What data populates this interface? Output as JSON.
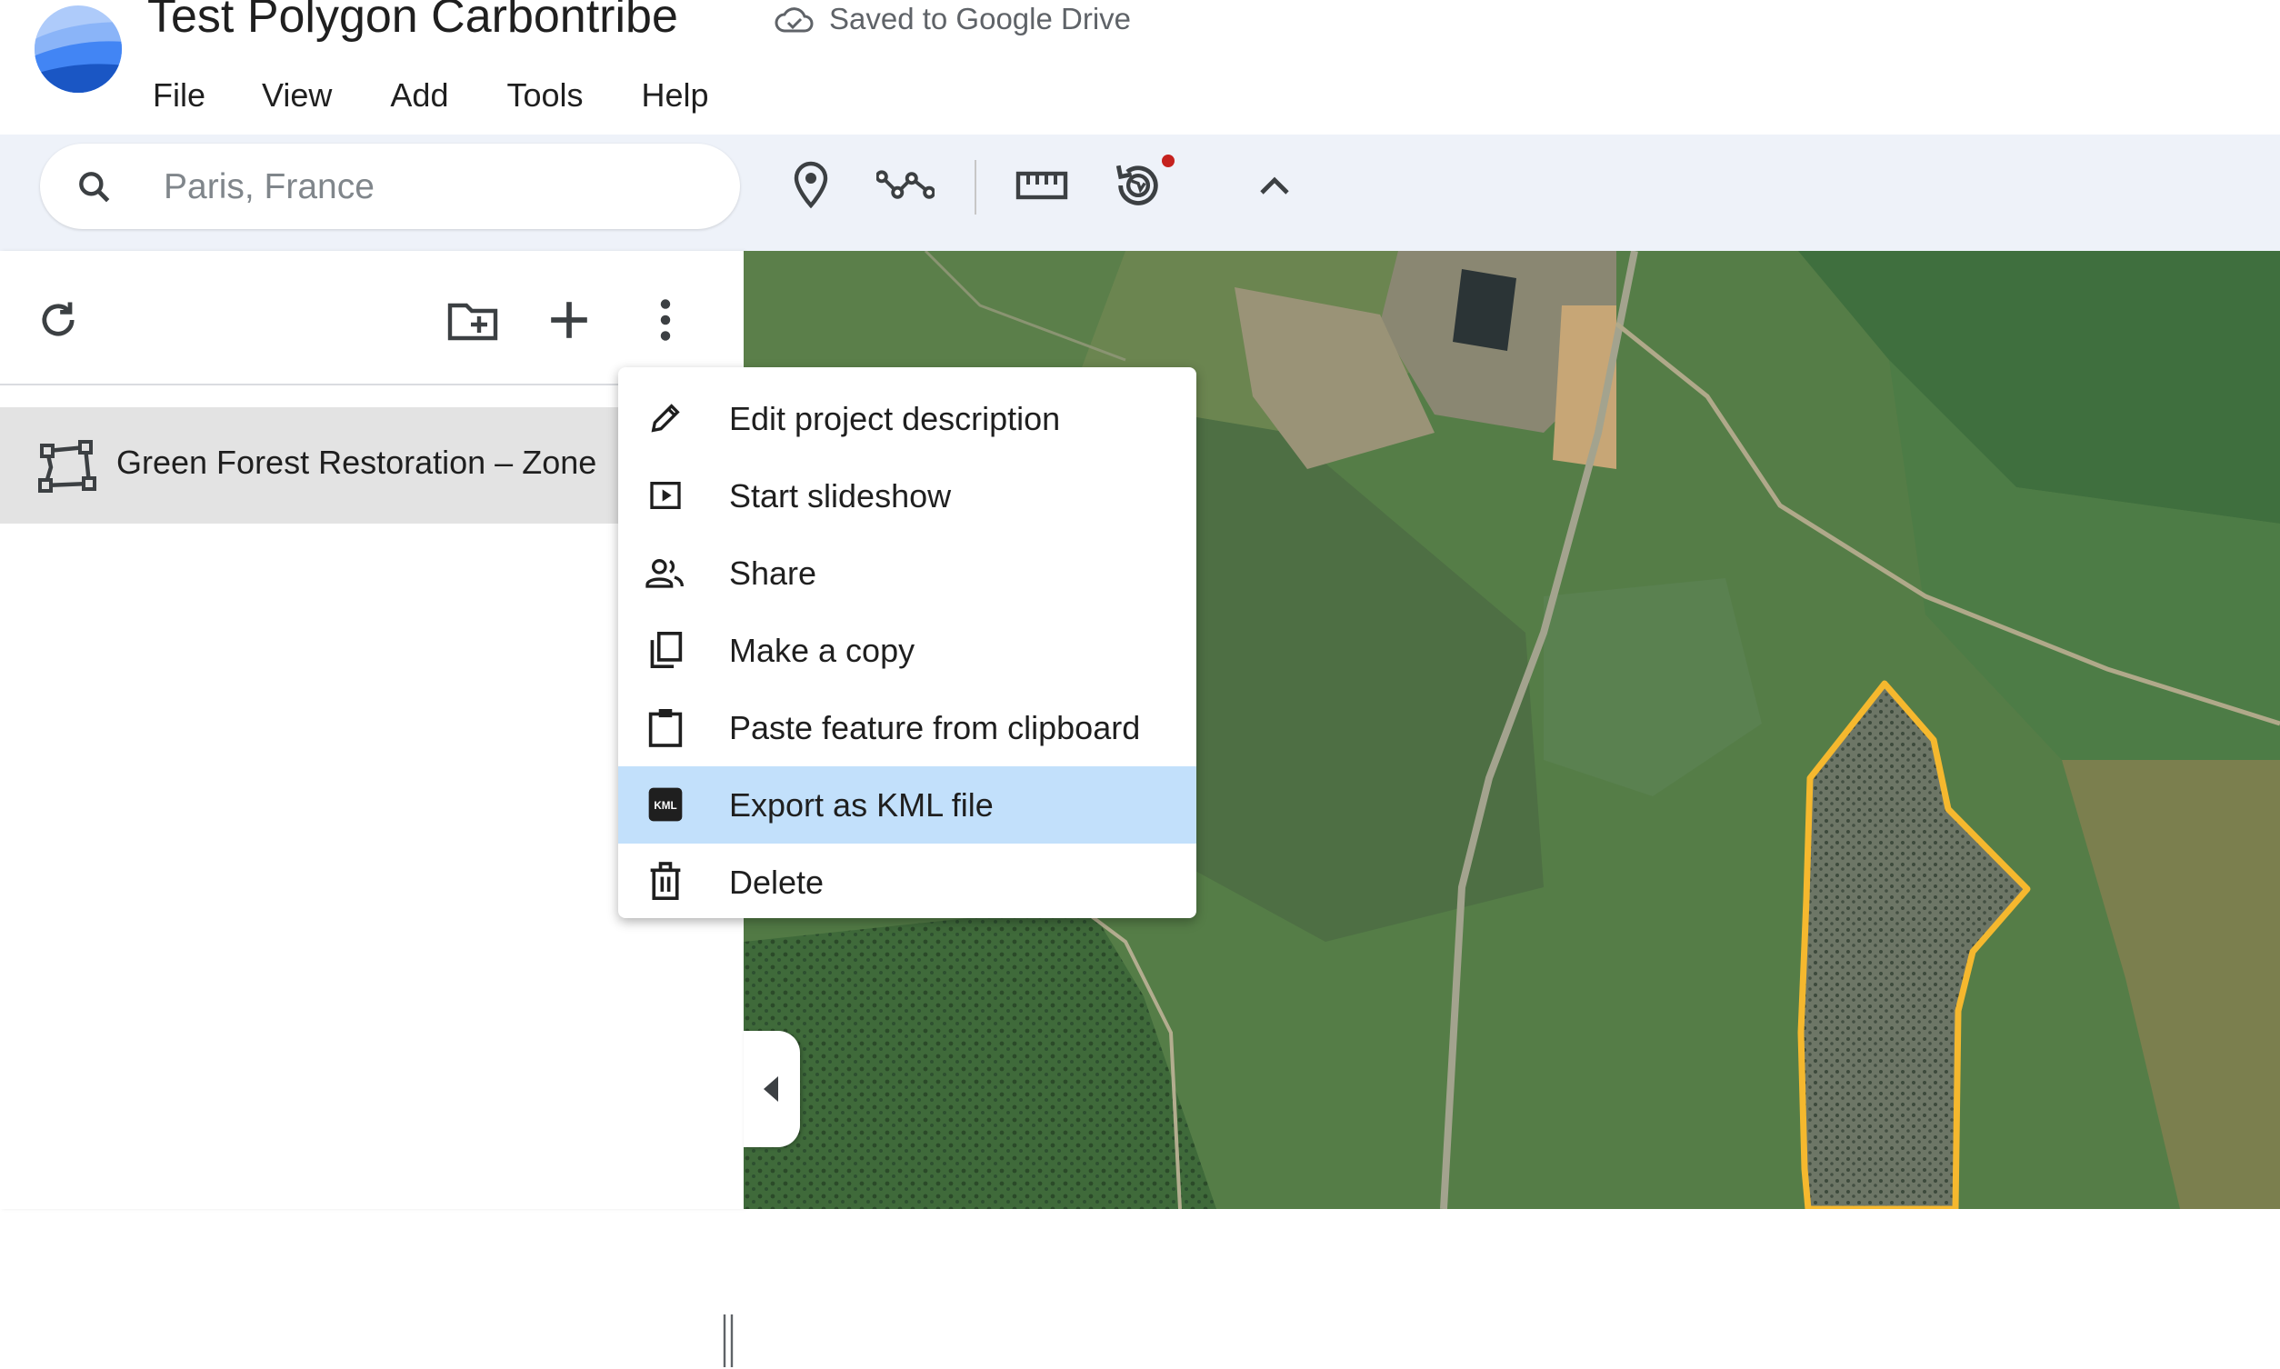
{
  "app": {
    "title": "Test Polygon Carbontribe",
    "save_status": "Saved to Google Drive"
  },
  "menubar": [
    "File",
    "View",
    "Add",
    "Tools",
    "Help"
  ],
  "search": {
    "placeholder": "Paris, France",
    "value": ""
  },
  "toolbar": {
    "icons": [
      "add-placemark-icon",
      "draw-line-icon",
      "measure-icon",
      "voyager-icon",
      "collapse-toolbar-icon"
    ],
    "notification_dot_color": "#c5221f"
  },
  "sidebar": {
    "actions": [
      "refresh-icon",
      "new-folder-icon",
      "add-icon",
      "more-vert-icon"
    ],
    "features": [
      {
        "label": "Green Forest Restoration – Zone",
        "icon": "polygon-icon"
      }
    ]
  },
  "context_menu": {
    "items": [
      {
        "label": "Edit project description",
        "icon": "pencil-icon"
      },
      {
        "label": "Start slideshow",
        "icon": "slideshow-icon"
      },
      {
        "label": "Share",
        "icon": "people-icon"
      },
      {
        "label": "Make a copy",
        "icon": "copy-icon"
      },
      {
        "label": "Paste feature from clipboard",
        "icon": "clipboard-icon"
      },
      {
        "label": "Export as KML file",
        "icon": "kml-icon",
        "highlighted": true
      },
      {
        "label": "Delete",
        "icon": "trash-icon"
      }
    ],
    "highlight_color": "#c2e0fb"
  },
  "map": {
    "polygon_color": "#f5b82e"
  }
}
